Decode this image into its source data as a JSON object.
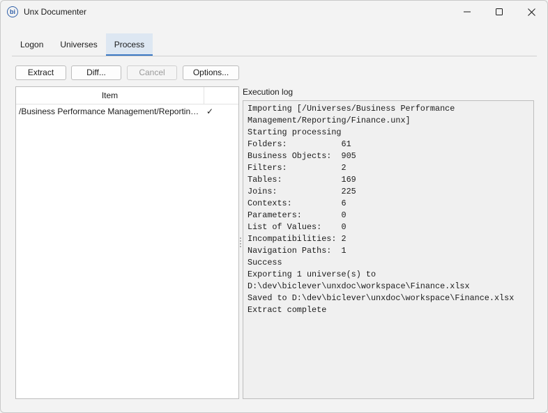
{
  "window": {
    "title": "Unx Documenter",
    "icon": "bi-logo-icon"
  },
  "tabs": [
    {
      "label": "Logon",
      "active": false
    },
    {
      "label": "Universes",
      "active": false
    },
    {
      "label": "Process",
      "active": true
    }
  ],
  "toolbar": {
    "extract_label": "Extract",
    "diff_label": "Diff...",
    "cancel_label": "Cancel",
    "options_label": "Options..."
  },
  "item_list": {
    "header_item": "Item",
    "header_status": "",
    "rows": [
      {
        "path": "/Business Performance Management/Reporting/Finance.unx",
        "status": "✓"
      }
    ]
  },
  "log": {
    "label": "Execution log",
    "lines": [
      "Importing [/Universes/Business Performance",
      "Management/Reporting/Finance.unx]",
      "Starting processing",
      "Folders:           61",
      "Business Objects:  905",
      "Filters:           2",
      "Tables:            169",
      "Joins:             225",
      "Contexts:          6",
      "Parameters:        0",
      "List of Values:    0",
      "Incompatibilities: 2",
      "Navigation Paths:  1",
      "Success",
      "Exporting 1 universe(s) to",
      "D:\\dev\\biclever\\unxdoc\\workspace\\Finance.xlsx",
      "Saved to D:\\dev\\biclever\\unxdoc\\workspace\\Finance.xlsx",
      "Extract complete"
    ]
  },
  "colors": {
    "accent": "#3a78c4",
    "active_tab_bg": "#dde7f2",
    "window_bg": "#f3f3f3"
  }
}
